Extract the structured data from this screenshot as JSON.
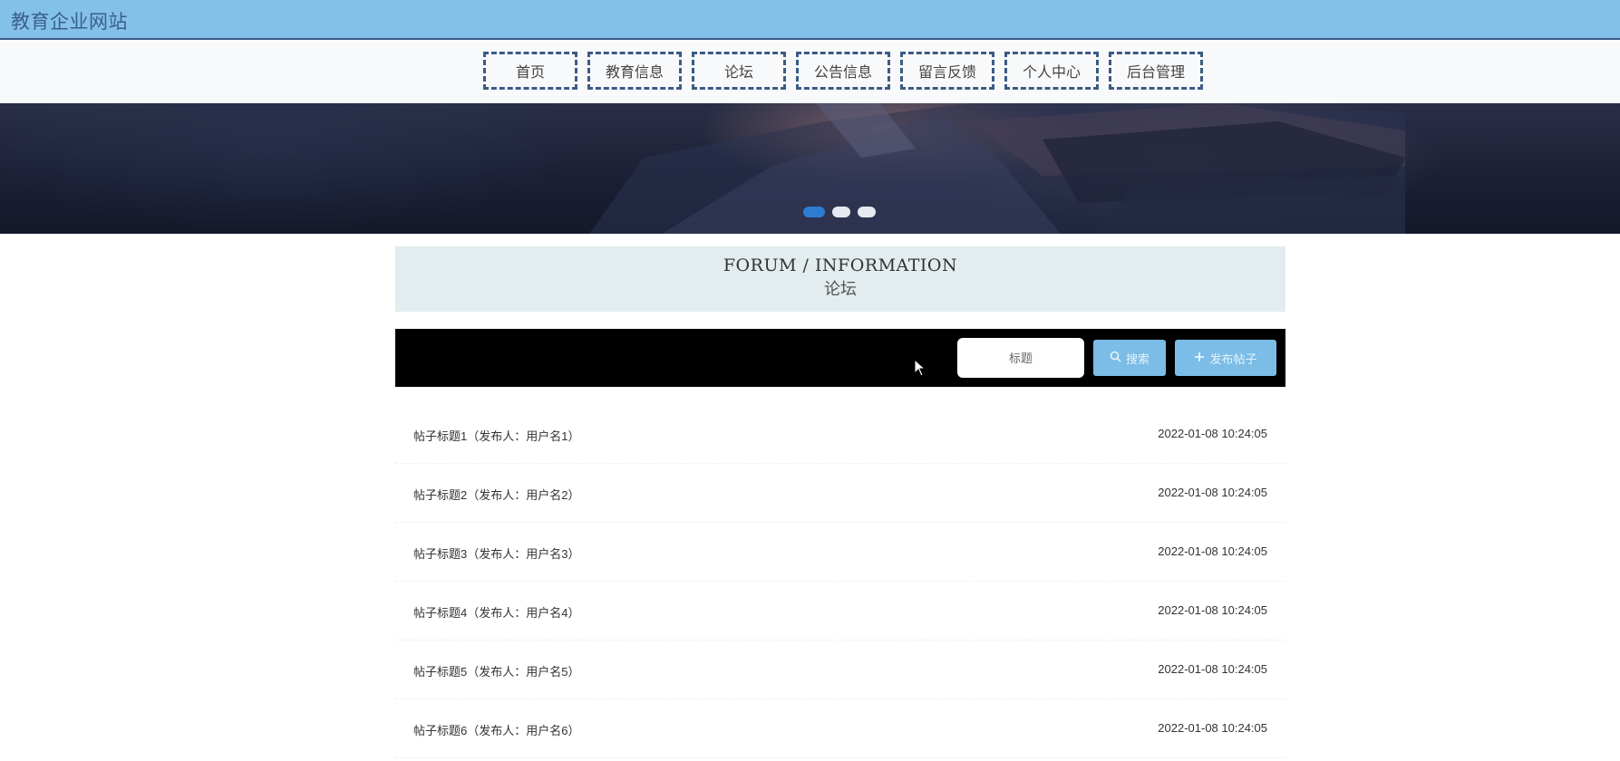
{
  "header": {
    "site_title": "教育企业网站"
  },
  "nav": {
    "items": [
      {
        "label": "首页"
      },
      {
        "label": "教育信息"
      },
      {
        "label": "论坛"
      },
      {
        "label": "公告信息"
      },
      {
        "label": "留言反馈"
      },
      {
        "label": "个人中心"
      },
      {
        "label": "后台管理"
      }
    ]
  },
  "banner": {
    "slide_count": 3,
    "active_slide": 1
  },
  "section": {
    "title_en": "FORUM / INFORMATION",
    "title_cn": "论坛"
  },
  "search": {
    "placeholder": "标题",
    "search_label": "搜索",
    "post_label": "发布帖子"
  },
  "posts": [
    {
      "title": "帖子标题1（发布人：用户名1）",
      "time": "2022-01-08 10:24:05"
    },
    {
      "title": "帖子标题2（发布人：用户名2）",
      "time": "2022-01-08 10:24:05"
    },
    {
      "title": "帖子标题3（发布人：用户名3）",
      "time": "2022-01-08 10:24:05"
    },
    {
      "title": "帖子标题4（发布人：用户名4）",
      "time": "2022-01-08 10:24:05"
    },
    {
      "title": "帖子标题5（发布人：用户名5）",
      "time": "2022-01-08 10:24:05"
    },
    {
      "title": "帖子标题6（发布人：用户名6）",
      "time": "2022-01-08 10:24:05"
    }
  ],
  "colors": {
    "topbar": "#83c1e8",
    "nav_border": "#3c5a84",
    "button": "#7bbde6",
    "dot_active": "#2c7dd2",
    "section_bg": "#e3ecee"
  }
}
